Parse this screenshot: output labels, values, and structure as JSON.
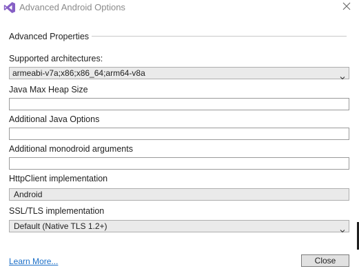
{
  "window": {
    "title": "Advanced Android Options",
    "logo_icon": "visual-studio-logo-icon",
    "close_icon": "close-icon"
  },
  "section": {
    "title": "Advanced Properties"
  },
  "fields": {
    "supported_architectures": {
      "label": "Supported architectures:",
      "value": "armeabi-v7a;x86;x86_64;arm64-v8a"
    },
    "java_max_heap_size": {
      "label": "Java Max Heap Size",
      "value": ""
    },
    "additional_java_options": {
      "label": "Additional Java Options",
      "value": ""
    },
    "additional_monodroid_arguments": {
      "label": "Additional monodroid arguments",
      "value": ""
    },
    "httpclient_implementation": {
      "label": "HttpClient implementation",
      "value": "Android"
    },
    "ssl_tls_implementation": {
      "label": "SSL/TLS implementation",
      "value": "Default (Native TLS 1.2+)"
    }
  },
  "footer": {
    "learn_more": "Learn More...",
    "close_button": "Close"
  },
  "colors": {
    "link": "#1a6ec7",
    "logo_purple": "#865fc5",
    "disabled_combo": "#eaeaea"
  }
}
